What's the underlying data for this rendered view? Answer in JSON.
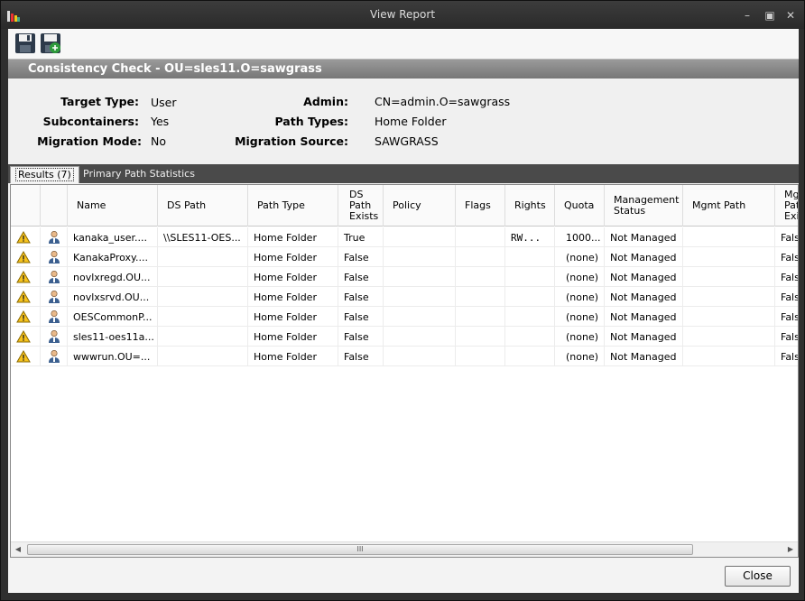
{
  "window": {
    "title": "View Report"
  },
  "toolbar": {
    "save_icon": "save-icon",
    "save_as_icon": "save-as-icon"
  },
  "header": {
    "title": "Consistency Check - OU=sles11.O=sawgrass"
  },
  "summary": {
    "target_type_label": "Target Type:",
    "target_type_value": "User",
    "subcontainers_label": "Subcontainers:",
    "subcontainers_value": "Yes",
    "migration_mode_label": "Migration Mode:",
    "migration_mode_value": "No",
    "admin_label": "Admin:",
    "admin_value": "CN=admin.O=sawgrass",
    "path_types_label": "Path Types:",
    "path_types_value": "Home Folder",
    "migration_source_label": "Migration Source:",
    "migration_source_value": "SAWGRASS"
  },
  "tabs": [
    {
      "label": "Results  (7)"
    },
    {
      "label": "Primary Path Statistics"
    }
  ],
  "columns": [
    "",
    "",
    "Name",
    "DS Path",
    "Path Type",
    "DS Path Exists",
    "Policy",
    "Flags",
    "Rights",
    "Quota",
    "Management Status",
    "Mgmt Path",
    "Mgmt Path Exists"
  ],
  "rows": [
    {
      "name": "kanaka_user....",
      "ds_path": "\\\\SLES11-OES...",
      "path_type": "Home Folder",
      "exists": "True",
      "policy": "",
      "flags": "",
      "rights": "RW...",
      "quota": "1000...",
      "status": "Not Managed",
      "mgmt_path": "",
      "mgmt_exists": "False"
    },
    {
      "name": "KanakaProxy....",
      "ds_path": "",
      "path_type": "Home Folder",
      "exists": "False",
      "policy": "",
      "flags": "",
      "rights": "",
      "quota": "(none)",
      "status": "Not Managed",
      "mgmt_path": "",
      "mgmt_exists": "False"
    },
    {
      "name": "novlxregd.OU...",
      "ds_path": "",
      "path_type": "Home Folder",
      "exists": "False",
      "policy": "",
      "flags": "",
      "rights": "",
      "quota": "(none)",
      "status": "Not Managed",
      "mgmt_path": "",
      "mgmt_exists": "False"
    },
    {
      "name": "novlxsrvd.OU...",
      "ds_path": "",
      "path_type": "Home Folder",
      "exists": "False",
      "policy": "",
      "flags": "",
      "rights": "",
      "quota": "(none)",
      "status": "Not Managed",
      "mgmt_path": "",
      "mgmt_exists": "False"
    },
    {
      "name": "OESCommonP...",
      "ds_path": "",
      "path_type": "Home Folder",
      "exists": "False",
      "policy": "",
      "flags": "",
      "rights": "",
      "quota": "(none)",
      "status": "Not Managed",
      "mgmt_path": "",
      "mgmt_exists": "False"
    },
    {
      "name": "sles11-oes11a...",
      "ds_path": "",
      "path_type": "Home Folder",
      "exists": "False",
      "policy": "",
      "flags": "",
      "rights": "",
      "quota": "(none)",
      "status": "Not Managed",
      "mgmt_path": "",
      "mgmt_exists": "False"
    },
    {
      "name": "wwwrun.OU=...",
      "ds_path": "",
      "path_type": "Home Folder",
      "exists": "False",
      "policy": "",
      "flags": "",
      "rights": "",
      "quota": "(none)",
      "status": "Not Managed",
      "mgmt_path": "",
      "mgmt_exists": "False"
    }
  ],
  "scrollbar": {
    "grip": "III"
  },
  "footer": {
    "close_label": "Close"
  }
}
